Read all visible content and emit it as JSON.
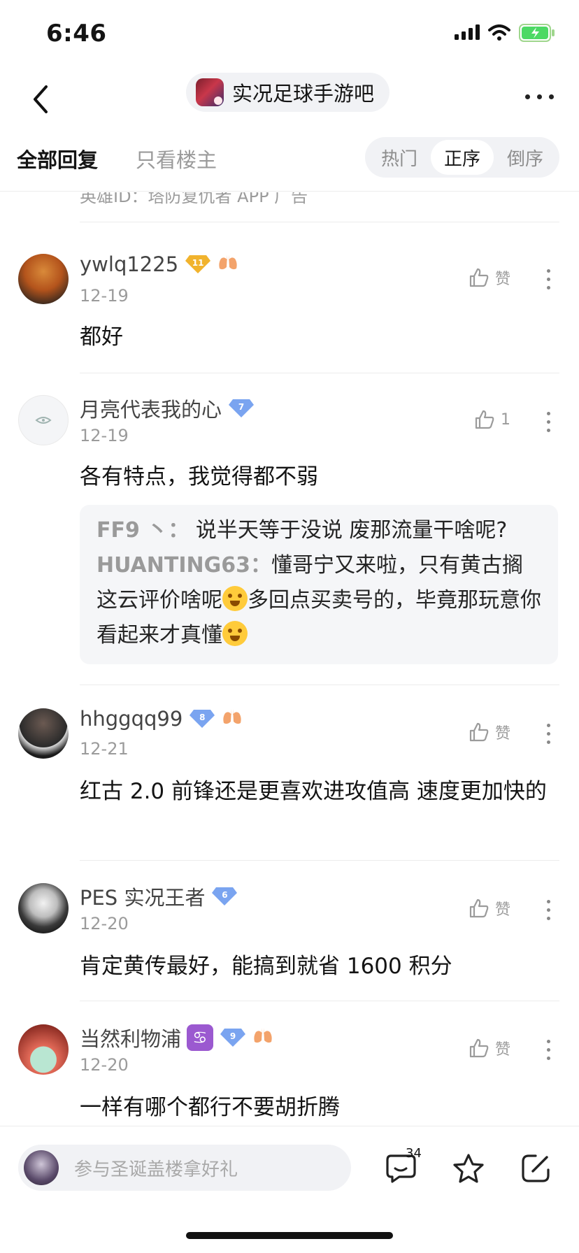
{
  "status_bar": {
    "time": "6:46"
  },
  "header": {
    "forum_name": "实况足球手游吧"
  },
  "tabs": {
    "all_replies": "全部回复",
    "owner_only": "只看楼主"
  },
  "sort": {
    "hot": "热门",
    "asc": "正序",
    "desc": "倒序",
    "active": "正序"
  },
  "prev_tail": "英雄ID：塔防复仇者  APP 广告",
  "posts": [
    {
      "username": "ywlq1225",
      "level": "11",
      "level_color": "#f1b32d",
      "date": "12-19",
      "like": "赞",
      "content": "都好"
    },
    {
      "username": "月亮代表我的心",
      "level": "7",
      "level_color": "#7aa4f0",
      "date": "12-19",
      "like": "1",
      "content": "各有特点，我觉得都不弱",
      "replies": [
        {
          "name": "FF9 丶",
          "sep": "：",
          "text": "说半天等于没说 废那流量干啥呢?"
        },
        {
          "name": "HUANTING63",
          "sep": "：",
          "text_a": "懂哥宁又来啦，只有黄古搁这云评价啥呢",
          "text_b": "多回点买卖号的，毕竟那玩意你看起来才真懂"
        }
      ]
    },
    {
      "username": "hhggqq99",
      "level": "8",
      "level_color": "#7aa4f0",
      "date": "12-21",
      "like": "赞",
      "content": "红古 2.0 前锋还是更喜欢进攻值高 速度更加快的"
    },
    {
      "username": "PES 实况王者",
      "level": "6",
      "level_color": "#7aa4f0",
      "date": "12-20",
      "like": "赞",
      "content": "肯定黄传最好，能搞到就省 1600 积分"
    },
    {
      "username": "当然利物浦",
      "zodiac": "♋",
      "level": "9",
      "level_color": "#7aa4f0",
      "date": "12-20",
      "like": "赞",
      "content": "一样有哪个都行不要胡折腾"
    }
  ],
  "bottom": {
    "input_placeholder": "参与圣诞盖楼拿好礼",
    "comment_count": "34"
  }
}
